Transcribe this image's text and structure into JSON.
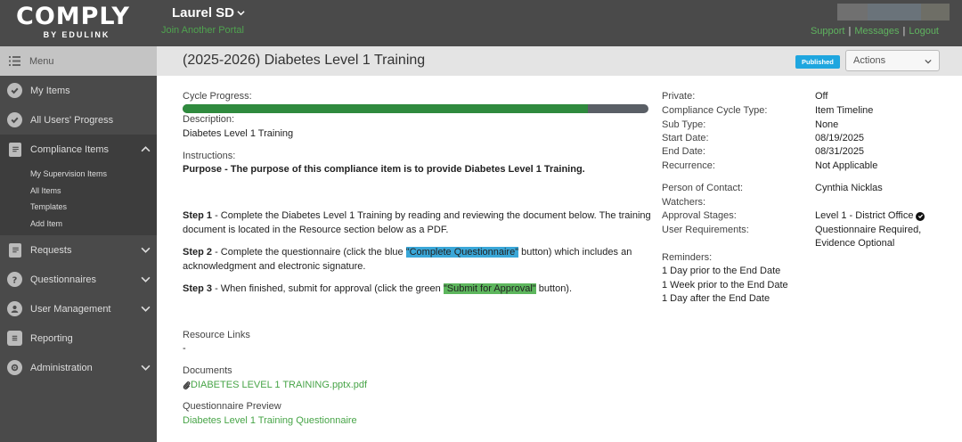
{
  "header": {
    "logo_main": "COMPLY",
    "logo_sub": "BY EDULINK",
    "portal_name": "Laurel SD",
    "join_portal": "Join Another Portal",
    "links": [
      "Support",
      "Messages",
      "Logout"
    ],
    "separator": "|"
  },
  "sidebar": {
    "menu_label": "Menu",
    "items": [
      {
        "label": "My Items",
        "icon": "check-circle-icon"
      },
      {
        "label": "All Users' Progress",
        "icon": "check-circle-icon"
      },
      {
        "label": "Compliance Items",
        "icon": "file-icon",
        "expanded": true,
        "children": [
          "My Supervision Items",
          "All Items",
          "Templates",
          "Add Item"
        ]
      },
      {
        "label": "Requests",
        "icon": "file-icon"
      },
      {
        "label": "Questionnaires",
        "icon": "question-icon"
      },
      {
        "label": "User Management",
        "icon": "user-icon"
      },
      {
        "label": "Reporting",
        "icon": "report-icon"
      },
      {
        "label": "Administration",
        "icon": "gear-icon"
      }
    ]
  },
  "title_bar": {
    "title": "(2025-2026) Diabetes Level 1 Training",
    "status_badge": "Published",
    "actions_label": "Actions"
  },
  "main": {
    "cycle_progress_label": "Cycle Progress:",
    "cycle_progress_fraction": 0.87,
    "description_label": "Description:",
    "description_value": "Diabetes Level 1 Training",
    "instructions_label": "Instructions:",
    "purpose_bold": "Purpose",
    "purpose_text": " - The purpose of this compliance item is to provide Diabetes Level 1 Training.",
    "step1_bold": "Step 1",
    "step1_text": " - Complete the Diabetes Level 1 Training by reading and reviewing the document below. The training document is located in the Resource section below as a PDF.",
    "step2_bold": "Step 2",
    "step2_pre": " - Complete the questionnaire (click the blue ",
    "step2_highlight": "\"Complete Questionnaire\"",
    "step2_post": " button) which includes an acknowledgment and electronic signature.",
    "step3_bold": "Step 3",
    "step3_pre": " - When finished, submit for approval (click the green ",
    "step3_highlight": "\"Submit for Approval\"",
    "step3_post": " button).",
    "resource_links_label": "Resource Links",
    "resource_links_value": "-",
    "documents_label": "Documents",
    "document_link": "DIABETES LEVEL 1 TRAINING.pptx.pdf",
    "questionnaire_preview_label": "Questionnaire Preview",
    "questionnaire_link": "Diabetes Level 1 Training Questionnaire"
  },
  "details": {
    "private_label": "Private:",
    "private_value": "Off",
    "cycle_type_label": "Compliance Cycle Type:",
    "cycle_type_value": "Item Timeline",
    "sub_type_label": "Sub Type:",
    "sub_type_value": "None",
    "start_date_label": "Start Date:",
    "start_date_value": "08/19/2025",
    "end_date_label": "End Date:",
    "end_date_value": "08/31/2025",
    "recurrence_label": "Recurrence:",
    "recurrence_value": "Not Applicable",
    "contact_label": "Person of Contact:",
    "contact_value": "Cynthia Nicklas",
    "watchers_label": "Watchers:",
    "approval_label": "Approval Stages:",
    "approval_value": "Level 1 - District Office",
    "user_req_label": "User Requirements:",
    "user_req_line1": "Questionnaire Required,",
    "user_req_line2": "Evidence Optional",
    "reminders_label": "Reminders:",
    "reminders": [
      "1 Day prior to the End Date",
      "1 Week prior to the End Date",
      "1 Day after the End Date"
    ]
  }
}
